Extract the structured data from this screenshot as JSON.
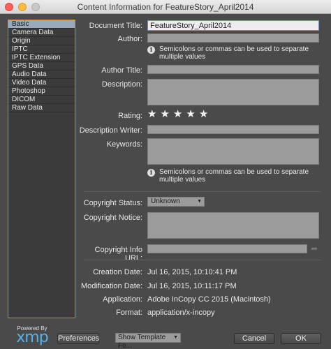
{
  "window": {
    "title": "Content Information for FeatureStory_April2014"
  },
  "sidebar": {
    "items": [
      {
        "label": "Basic"
      },
      {
        "label": "Camera Data"
      },
      {
        "label": "Origin"
      },
      {
        "label": "IPTC"
      },
      {
        "label": "IPTC Extension"
      },
      {
        "label": "GPS Data"
      },
      {
        "label": "Audio Data"
      },
      {
        "label": "Video Data"
      },
      {
        "label": "Photoshop"
      },
      {
        "label": "DICOM"
      },
      {
        "label": "Raw Data"
      }
    ],
    "selected": "Basic"
  },
  "form": {
    "document_title_label": "Document Title:",
    "document_title_value": "FeatureStory_April2014",
    "author_label": "Author:",
    "author_value": "",
    "author_hint": "Semicolons or commas can be used to separate multiple values",
    "author_title_label": "Author Title:",
    "author_title_value": "",
    "description_label": "Description:",
    "description_value": "",
    "rating_label": "Rating:",
    "rating_stars": [
      "★",
      "★",
      "★",
      "★",
      "★"
    ],
    "description_writer_label": "Description Writer:",
    "description_writer_value": "",
    "keywords_label": "Keywords:",
    "keywords_value": "",
    "keywords_hint": "Semicolons or commas can be used to separate multiple values",
    "copyright_status_label": "Copyright Status:",
    "copyright_status_value": "Unknown",
    "copyright_notice_label": "Copyright Notice:",
    "copyright_notice_value": "",
    "copyright_url_label": "Copyright Info URL:",
    "copyright_url_value": "",
    "creation_date_label": "Creation Date:",
    "creation_date_value": "Jul 16, 2015, 10:10:41 PM",
    "modification_date_label": "Modification Date:",
    "modification_date_value": "Jul 16, 2015, 10:11:17 PM",
    "application_label": "Application:",
    "application_value": "Adobe InCopy CC 2015 (Macintosh)",
    "format_label": "Format:",
    "format_value": "application/x-incopy"
  },
  "footer": {
    "powered_by": "Powered By",
    "xmp_logo": "xmp",
    "preferences_label": "Preferences",
    "template_select_value": "Show Template Fo...",
    "cancel_label": "Cancel",
    "ok_label": "OK"
  },
  "colors": {
    "sidebar_border": "#c58a3c",
    "selected_item": "#9aa9be",
    "xmp_blue": "#5ab0e8"
  },
  "icons": {
    "info": "info-icon",
    "star": "star-icon",
    "dropdown": "chevron-down-icon",
    "url_go": "arrow-icon"
  }
}
